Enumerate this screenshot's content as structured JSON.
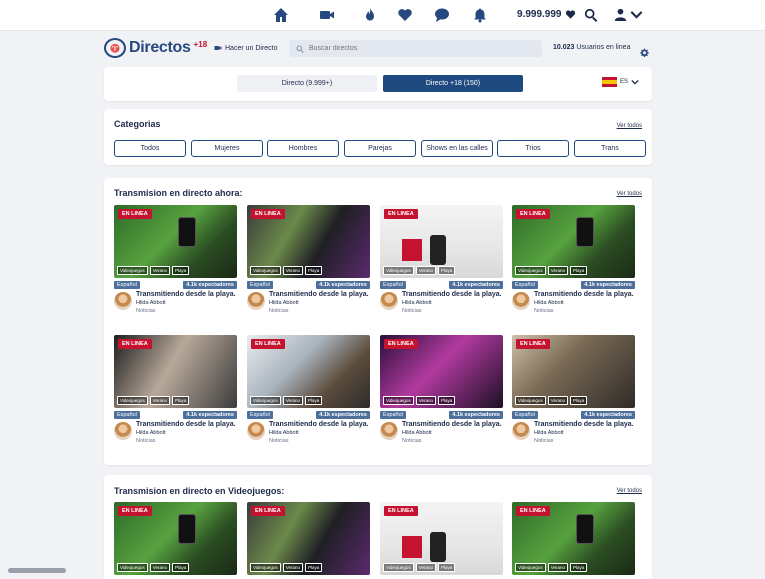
{
  "topbar": {
    "nav_icons": [
      "home-icon",
      "video-icon",
      "flame-icon",
      "heart-icon",
      "chat-icon",
      "bell-icon"
    ],
    "coins": "9.999.999",
    "user_icon": "user-icon"
  },
  "subbar": {
    "logo_text": "Directos",
    "logo_plus": "+18",
    "go_live": "Hacer un Directo",
    "search_placeholder": "Buscar directos",
    "users_count": "10.023",
    "users_label": "Usuarios en linea"
  },
  "toggle": {
    "option_a": "Directo (9.999+)",
    "option_b": "Directo +18 (150)",
    "language": "ES"
  },
  "categories": {
    "title": "Categorias",
    "see_all": "Ver todos",
    "items": [
      "Todos",
      "Mujeres",
      "Hombres",
      "Parejas",
      "Shows en las calles",
      "Trios",
      "Trans"
    ]
  },
  "live_now": {
    "title": "Transmision en directo ahora:",
    "see_all": "Ver todos",
    "streams": [
      {
        "badge": "EN LINEA",
        "tags": [
          "Videojuegos",
          "Verano",
          "Playa"
        ],
        "language": "Español",
        "viewers": "4.1k espectadores",
        "title": "Transmitiendo desde la playa.",
        "host": "Hilda Abbott",
        "category": "Noticias"
      },
      {
        "badge": "EN LINEA",
        "tags": [
          "Videojuegos",
          "Verano",
          "Playa"
        ],
        "language": "Español",
        "viewers": "4.1k espectadores",
        "title": "Transmitiendo desde la playa.",
        "host": "Hilda Abbott",
        "category": "Noticias"
      },
      {
        "badge": "EN LINEA",
        "tags": [
          "Videojuegos",
          "Verano",
          "Playa"
        ],
        "language": "Español",
        "viewers": "4.1k espectadores",
        "title": "Transmitiendo desde la playa.",
        "host": "Hilda Abbott",
        "category": "Noticias"
      },
      {
        "badge": "EN LINEA",
        "tags": [
          "Videojuegos",
          "Verano",
          "Playa"
        ],
        "language": "Español",
        "viewers": "4.1k espectadores",
        "title": "Transmitiendo desde la playa.",
        "host": "Hilda Abbott",
        "category": "Noticias"
      },
      {
        "badge": "EN LINEA",
        "tags": [
          "Videojuegos",
          "Verano",
          "Playa"
        ],
        "language": "Español",
        "viewers": "4.1k espectadores",
        "title": "Transmitiendo desde la playa.",
        "host": "Hilda Abbott",
        "category": "Noticias"
      },
      {
        "badge": "EN LINEA",
        "tags": [
          "Videojuegos",
          "Verano",
          "Playa"
        ],
        "language": "Español",
        "viewers": "4.1k espectadores",
        "title": "Transmitiendo desde la playa.",
        "host": "Hilda Abbott",
        "category": "Noticias"
      },
      {
        "badge": "EN LINEA",
        "tags": [
          "Videojuegos",
          "Verano",
          "Playa"
        ],
        "language": "Español",
        "viewers": "4.1k espectadores",
        "title": "Transmitiendo desde la playa.",
        "host": "Hilda Abbott",
        "category": "Noticias"
      },
      {
        "badge": "EN LINEA",
        "tags": [
          "Videojuegos",
          "Verano",
          "Playa"
        ],
        "language": "Español",
        "viewers": "4.1k espectadores",
        "title": "Transmitiendo desde la playa.",
        "host": "Hilda Abbott",
        "category": "Noticias"
      }
    ]
  },
  "games": {
    "title": "Transmision en directo en Videojuegos:",
    "see_all": "Ver todos",
    "streams": [
      {
        "badge": "EN LINEA",
        "tags": [
          "Videojuegos",
          "Verano",
          "Playa"
        ]
      },
      {
        "badge": "EN LINEA",
        "tags": [
          "Videojuegos",
          "Verano",
          "Playa"
        ]
      },
      {
        "badge": "EN LINEA",
        "tags": [
          "Videojuegos",
          "Verano",
          "Playa"
        ]
      },
      {
        "badge": "EN LINEA",
        "tags": [
          "Videojuegos",
          "Verano",
          "Playa"
        ]
      }
    ]
  },
  "colors": {
    "primary": "#1f4a80",
    "live_red": "#c4122f",
    "pill_blue": "#4c6f9c"
  }
}
